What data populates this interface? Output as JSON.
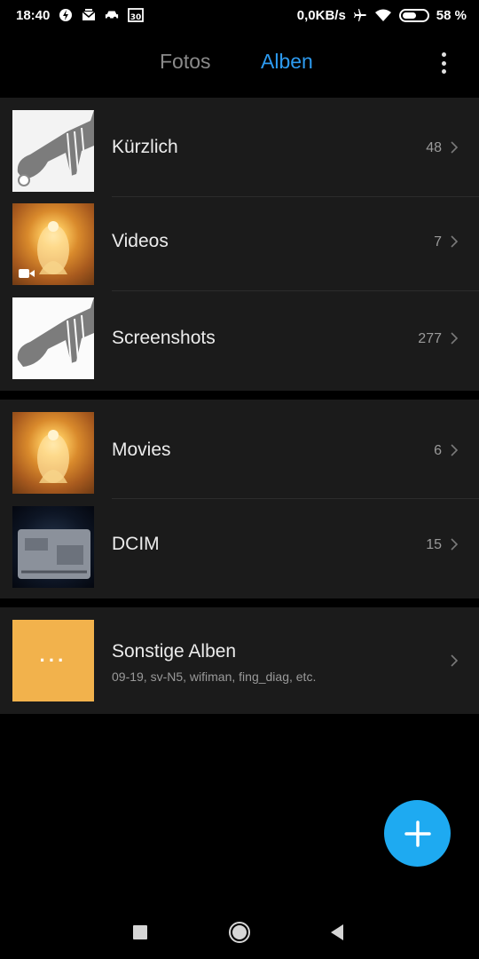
{
  "status_bar": {
    "time": "18:40",
    "network_speed": "0,0KB/s",
    "battery_percent": "58 %",
    "battery_level": 0.58,
    "calendar_day": "30",
    "left_icons": [
      "charging-bolt-icon",
      "mail-icon",
      "car-icon",
      "calendar-icon"
    ],
    "right_icons": [
      "airplane-icon",
      "wifi-icon",
      "battery-icon"
    ]
  },
  "header": {
    "tabs": [
      {
        "label": "Fotos",
        "active": false
      },
      {
        "label": "Alben",
        "active": true
      }
    ],
    "menu_icon": "more-vertical-icon"
  },
  "albums": [
    {
      "name": "Kürzlich",
      "count": "48",
      "thumb": "spork",
      "badge": "clock"
    },
    {
      "name": "Videos",
      "count": "7",
      "thumb": "golden-figure",
      "badge": "video"
    },
    {
      "name": "Screenshots",
      "count": "277",
      "thumb": "spork",
      "badge": null
    }
  ],
  "albums_group2": [
    {
      "name": "Movies",
      "count": "6",
      "thumb": "golden-figure"
    },
    {
      "name": "DCIM",
      "count": "15",
      "thumb": "laptop-underside"
    }
  ],
  "other_albums": {
    "name": "Sonstige Alben",
    "subtitle": "09-19, sv-N5, wifiman, fing_diag, etc.",
    "thumb_glyph": "···"
  },
  "fab": {
    "icon": "plus-icon",
    "color": "#1eaaf1"
  },
  "colors": {
    "accent": "#2d9bf0",
    "inactive_tab": "#8a8a8a",
    "group_bg": "#1b1b1b",
    "other_albums_thumb": "#f2b24c"
  },
  "navbar": {
    "buttons": [
      "recents-square-icon",
      "home-circle-icon",
      "back-triangle-icon"
    ]
  }
}
